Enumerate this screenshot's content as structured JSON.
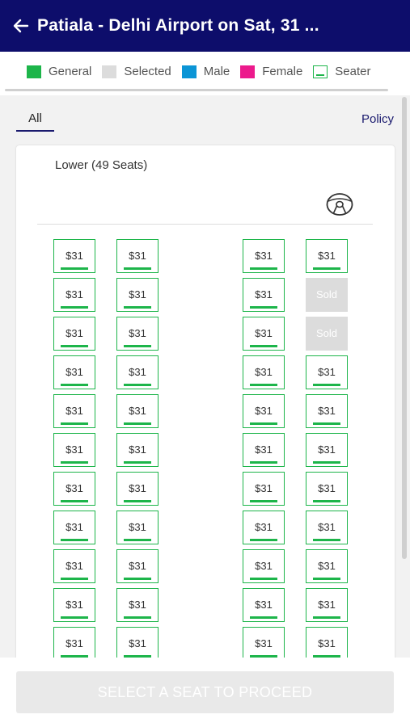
{
  "header": {
    "title": "Patiala - Delhi Airport on Sat, 31 ...",
    "back_icon": "arrow-left-icon"
  },
  "legend": [
    {
      "label": "General",
      "color": "#1db54a",
      "type": "swatch"
    },
    {
      "label": "Selected",
      "color": "#dcdcdc",
      "type": "swatch"
    },
    {
      "label": "Male",
      "color": "#0b95d6",
      "type": "swatch"
    },
    {
      "label": "Female",
      "color": "#ec1a8c",
      "type": "swatch"
    },
    {
      "label": "Seater",
      "color": "#1db54a",
      "type": "seater"
    }
  ],
  "tabs": {
    "all": "All",
    "policy": "Policy"
  },
  "deck": {
    "title": "Lower (49 Seats)",
    "steering_icon": "steering-wheel-icon",
    "rows": [
      [
        "$31",
        "$31",
        "$31",
        "$31"
      ],
      [
        "$31",
        "$31",
        "$31",
        "Sold"
      ],
      [
        "$31",
        "$31",
        "$31",
        "Sold"
      ],
      [
        "$31",
        "$31",
        "$31",
        "$31"
      ],
      [
        "$31",
        "$31",
        "$31",
        "$31"
      ],
      [
        "$31",
        "$31",
        "$31",
        "$31"
      ],
      [
        "$31",
        "$31",
        "$31",
        "$31"
      ],
      [
        "$31",
        "$31",
        "$31",
        "$31"
      ],
      [
        "$31",
        "$31",
        "$31",
        "$31"
      ],
      [
        "$31",
        "$31",
        "$31",
        "$31"
      ],
      [
        "$31",
        "$31",
        "$31",
        "$31"
      ]
    ]
  },
  "footer": {
    "proceed_label": "SELECT A SEAT TO PROCEED"
  }
}
